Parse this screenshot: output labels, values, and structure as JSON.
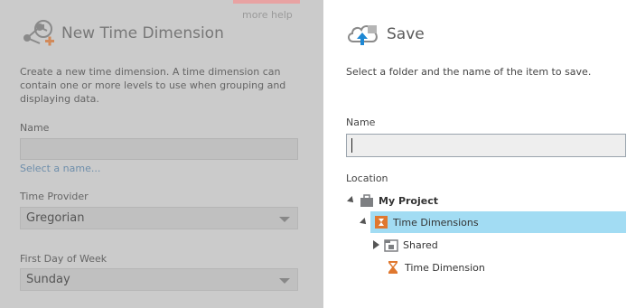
{
  "left_panel": {
    "more_help": "more help",
    "title": "New Time Dimension",
    "description": "Create a new time dimension. A time dimension can contain one or more levels to use when grouping and displaying data.",
    "name_label": "Name",
    "name_value": "",
    "select_link": "Select a name...",
    "time_provider_label": "Time Provider",
    "time_provider_value": "Gregorian",
    "first_day_label": "First Day of Week",
    "first_day_value": "Sunday"
  },
  "save_dialog": {
    "title": "Save",
    "description": "Select a folder and the name of the item to save.",
    "name_label": "Name",
    "name_value": "",
    "location_label": "Location",
    "tree": [
      {
        "label": "My Project",
        "icon": "briefcase-icon",
        "bold": true,
        "expanded": true,
        "selected": false
      },
      {
        "label": "Time Dimensions",
        "icon": "time-dimension-folder-icon",
        "bold": false,
        "expanded": true,
        "selected": true
      },
      {
        "label": "Shared",
        "icon": "shared-folder-icon",
        "bold": false,
        "expanded": false,
        "selected": false
      },
      {
        "label": "Time Dimension",
        "icon": "hourglass-icon",
        "bold": false,
        "expanded": null,
        "selected": false
      }
    ]
  },
  "colors": {
    "overlay_gray": "#cbcbcb",
    "selection_blue": "#a2dcf3",
    "accent_orange": "#e0782f",
    "link_blue": "#6e8eab"
  }
}
